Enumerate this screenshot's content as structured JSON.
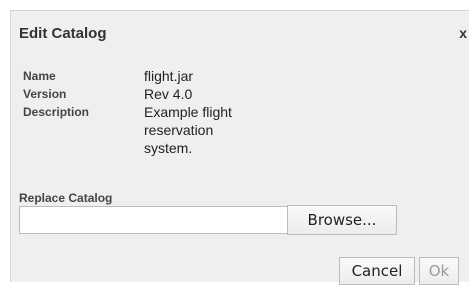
{
  "dialog": {
    "title": "Edit Catalog",
    "close_label": "x"
  },
  "fields": {
    "name_label": "Name",
    "name_value": "flight.jar",
    "version_label": "Version",
    "version_value": "Rev 4.0",
    "description_label": "Description",
    "description_value": "Example flight reservation system."
  },
  "replace": {
    "label": "Replace Catalog",
    "file_value": "",
    "browse_label": "Browse..."
  },
  "footer": {
    "cancel_label": "Cancel",
    "ok_label": "Ok",
    "ok_enabled": false
  }
}
